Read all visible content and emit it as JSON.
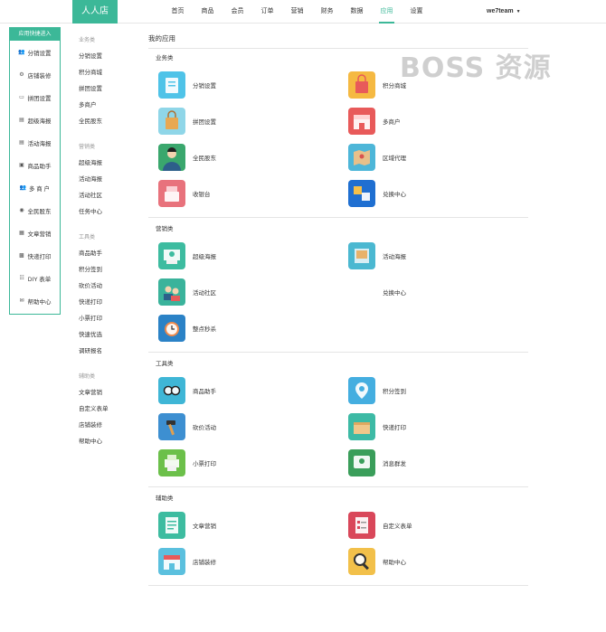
{
  "header": {
    "brand": "人人店",
    "nav": [
      "首页",
      "商品",
      "会员",
      "订单",
      "营销",
      "财务",
      "数据",
      "应用",
      "设置"
    ],
    "active_index": 7,
    "user": "we7team",
    "accent": "#3cb898"
  },
  "quick": {
    "title": "应用快捷进入",
    "items": [
      {
        "label": "分销设置",
        "icon": "users-icon"
      },
      {
        "label": "店铺装修",
        "icon": "gear-icon"
      },
      {
        "label": "拼团设置",
        "icon": "card-icon"
      },
      {
        "label": "超级海报",
        "icon": "doc-icon"
      },
      {
        "label": "活动海报",
        "icon": "doc-icon"
      },
      {
        "label": "商品助手",
        "icon": "car-icon"
      },
      {
        "label": "多 商 户",
        "icon": "users-icon"
      },
      {
        "label": "全民股东",
        "icon": "coin-icon"
      },
      {
        "label": "文章营销",
        "icon": "article-icon"
      },
      {
        "label": "快递打印",
        "icon": "print-icon"
      },
      {
        "label": "DIY 表单",
        "icon": "form-icon"
      },
      {
        "label": "帮助中心",
        "icon": "help-icon"
      }
    ]
  },
  "categories": [
    {
      "head": "业务类",
      "links": [
        "分销设置",
        "积分商城",
        "拼团设置",
        "多商户",
        "全民股东"
      ]
    },
    {
      "head": "营销类",
      "links": [
        "超级海报",
        "活动海报",
        "活动社区",
        "任务中心"
      ]
    },
    {
      "head": "工具类",
      "links": [
        "商品助手",
        "积分签到",
        "砍价活动",
        "快递打印",
        "小票打印",
        "快速优选",
        "调研报名"
      ]
    },
    {
      "head": "辅助类",
      "links": [
        "文章营销",
        "自定义表单",
        "店铺装修",
        "帮助中心"
      ]
    }
  ],
  "main": {
    "title": "我的应用",
    "sections": [
      {
        "title": "业务类",
        "apps": [
          {
            "label": "分销设置",
            "icon": "distribution-icon",
            "color": "#4fc3e8"
          },
          {
            "label": "积分商城",
            "icon": "shopping-bag-icon",
            "color": "#f5b942"
          },
          {
            "label": "拼团设置",
            "icon": "group-bag-icon",
            "color": "#8fd6e8"
          },
          {
            "label": "多商户",
            "icon": "storefront-icon",
            "color": "#e85a5a"
          },
          {
            "label": "全民股东",
            "icon": "person-icon",
            "color": "#3aa76d"
          },
          {
            "label": "区域代理",
            "icon": "map-icon",
            "color": "#4db6d8"
          },
          {
            "label": "收银台",
            "icon": "register-icon",
            "color": "#e8727c"
          },
          {
            "label": "兑换中心",
            "icon": "exchange-icon",
            "color": "#1f6fd1"
          }
        ]
      },
      {
        "title": "营销类",
        "apps": [
          {
            "label": "超级海报",
            "icon": "poster-icon",
            "color": "#3dbca0"
          },
          {
            "label": "活动海报",
            "icon": "event-poster-icon",
            "color": "#4bb8d1"
          },
          {
            "label": "活动社区",
            "icon": "community-icon",
            "color": "#3ab39b"
          },
          {
            "label": "兑换中心",
            "icon": "exchange-icon",
            "color": "#ffffff"
          },
          {
            "label": "整点秒杀",
            "icon": "alarm-icon",
            "color": "#2b82c6"
          }
        ]
      },
      {
        "title": "工具类",
        "apps": [
          {
            "label": "商品助手",
            "icon": "glasses-icon",
            "color": "#3fb6d6"
          },
          {
            "label": "积分签到",
            "icon": "location-pin-icon",
            "color": "#44aee0"
          },
          {
            "label": "砍价活动",
            "icon": "hammer-icon",
            "color": "#3d8fd1"
          },
          {
            "label": "快递打印",
            "icon": "package-icon",
            "color": "#3dbaa5"
          },
          {
            "label": "小票打印",
            "icon": "receipt-printer-icon",
            "color": "#6cc04a"
          },
          {
            "label": "消息群发",
            "icon": "message-icon",
            "color": "#3a9e5a"
          }
        ]
      },
      {
        "title": "辅助类",
        "apps": [
          {
            "label": "文章营销",
            "icon": "article-icon",
            "color": "#3dbca0"
          },
          {
            "label": "自定义表单",
            "icon": "checklist-icon",
            "color": "#d9475a"
          },
          {
            "label": "店铺装修",
            "icon": "shop-icon",
            "color": "#5bc0de"
          },
          {
            "label": "帮助中心",
            "icon": "magnifier-icon",
            "color": "#f2c04a"
          }
        ]
      }
    ]
  },
  "watermark": "BOSS 资源"
}
